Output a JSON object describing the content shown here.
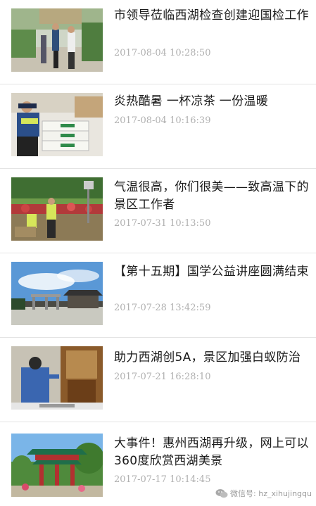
{
  "articles": [
    {
      "title": "市领导莅临西湖检查创建迎国检工作",
      "time": "2017-08-04 10:28:50",
      "thumb": "officials-walking-image"
    },
    {
      "title": "炎热酷暑 一杯凉茶 一份温暖",
      "time": "2017-08-04 10:16:39",
      "thumb": "police-tea-boxes-image"
    },
    {
      "title": "气温很高，你们很美——致高温下的景区工作者",
      "time": "2017-07-31 10:13:50",
      "thumb": "workers-garden-image"
    },
    {
      "title": "【第十五期】国学公益讲座圆满结束",
      "time": "2017-07-28 13:42:59",
      "thumb": "temple-sky-image"
    },
    {
      "title": "助力西湖创5A，景区加强白蚁防治",
      "time": "2017-07-21 16:28:10",
      "thumb": "termite-inspection-image"
    },
    {
      "title": "大事件！惠州西湖再升级，网上可以360度欣赏西湖美景",
      "time": "2017-07-17 10:14:45",
      "thumb": "pagoda-gate-image"
    }
  ],
  "watermark": {
    "text": "微信号: hz_xihujingqu",
    "icon": "wechat-icon"
  },
  "colors": {
    "divider": "#e4e4e4",
    "time": "#b0b0b0",
    "title": "#1a1a1a"
  }
}
